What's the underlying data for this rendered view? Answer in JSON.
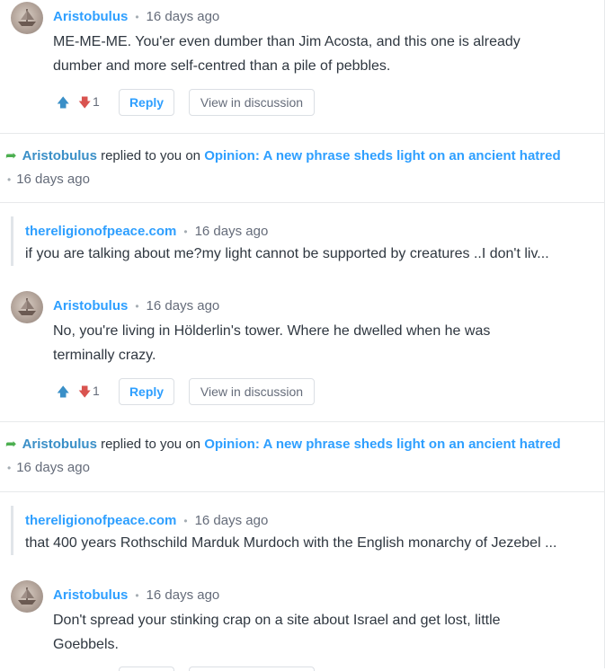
{
  "comments": [
    {
      "author": "Aristobulus",
      "time": "16 days ago",
      "text_lines": [
        "ME-ME-ME. You'er even dumber than Jim Acosta, and this one is already",
        "dumber and more self-centred than a pile of pebbles."
      ],
      "downvotes": "1",
      "reply_label": "Reply",
      "view_label": "View in discussion"
    },
    {
      "author": "Aristobulus",
      "time": "16 days ago",
      "text_lines": [
        "No, you're living in Hölderlin's tower. Where he dwelled when he was",
        "terminally crazy."
      ],
      "downvotes": "1",
      "reply_label": "Reply",
      "view_label": "View in discussion"
    },
    {
      "author": "Aristobulus",
      "time": "16 days ago",
      "text_lines": [
        "Don't spread your stinking crap on a site about Israel and get lost, little",
        "Goebbels."
      ]
    }
  ],
  "notices": [
    {
      "author": "Aristobulus",
      "middle": "replied to you on",
      "article": "Opinion: A new phrase sheds light on an ancient hatred",
      "time": "16 days ago"
    },
    {
      "author": "Aristobulus",
      "middle": "replied to you on",
      "article": "Opinion: A new phrase sheds light on an ancient hatred",
      "time": "16 days ago"
    }
  ],
  "quotes": [
    {
      "author": "thereligionofpeace.com",
      "time": "16 days ago",
      "text": "if you are talking about me?my light cannot be supported by creatures ..I don't liv..."
    },
    {
      "author": "thereligionofpeace.com",
      "time": "16 days ago",
      "text": "that 400 years Rothschild Marduk Murdoch with the English monarchy of Jezebel ..."
    }
  ],
  "icons": {
    "upvote": "arrow-up-icon",
    "downvote": "arrow-down-icon",
    "reply_arrow": "reply-arrow-icon",
    "avatar": "ship-avatar"
  },
  "colors": {
    "link": "#2e9fff",
    "downvote": "#d9534f",
    "reply_arrow": "#4caf50"
  }
}
